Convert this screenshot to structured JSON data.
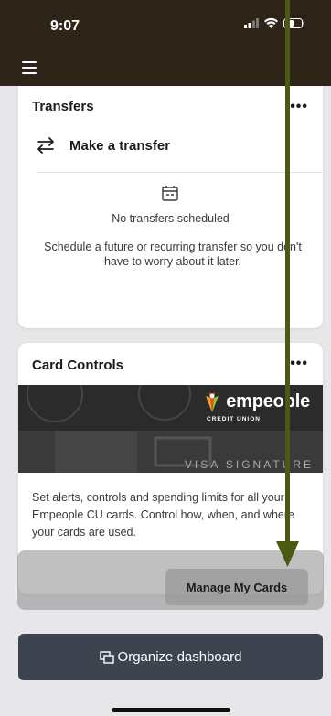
{
  "status_bar": {
    "time": "9:07"
  },
  "transfers_card": {
    "title": "Transfers",
    "more": "•••",
    "action_label": "Make a transfer",
    "empty_title": "No transfers scheduled",
    "empty_description": "Schedule a future or recurring transfer so you don't have to worry about it later."
  },
  "card_controls": {
    "title": "Card Controls",
    "more": "•••",
    "brand": "empeople",
    "brand_sub": "CREDIT UNION",
    "card_type": "VISA SIGNATURE",
    "description": "Set alerts, controls and spending limits for all your Empeople CU cards. Control how, when, and where your cards are used.",
    "manage_label": "Manage My Cards"
  },
  "organize_button": {
    "label": "Organize dashboard"
  },
  "colors": {
    "header_bg": "#2f2418",
    "arrow": "#4a5a12",
    "organize_bg": "#3d4450"
  }
}
